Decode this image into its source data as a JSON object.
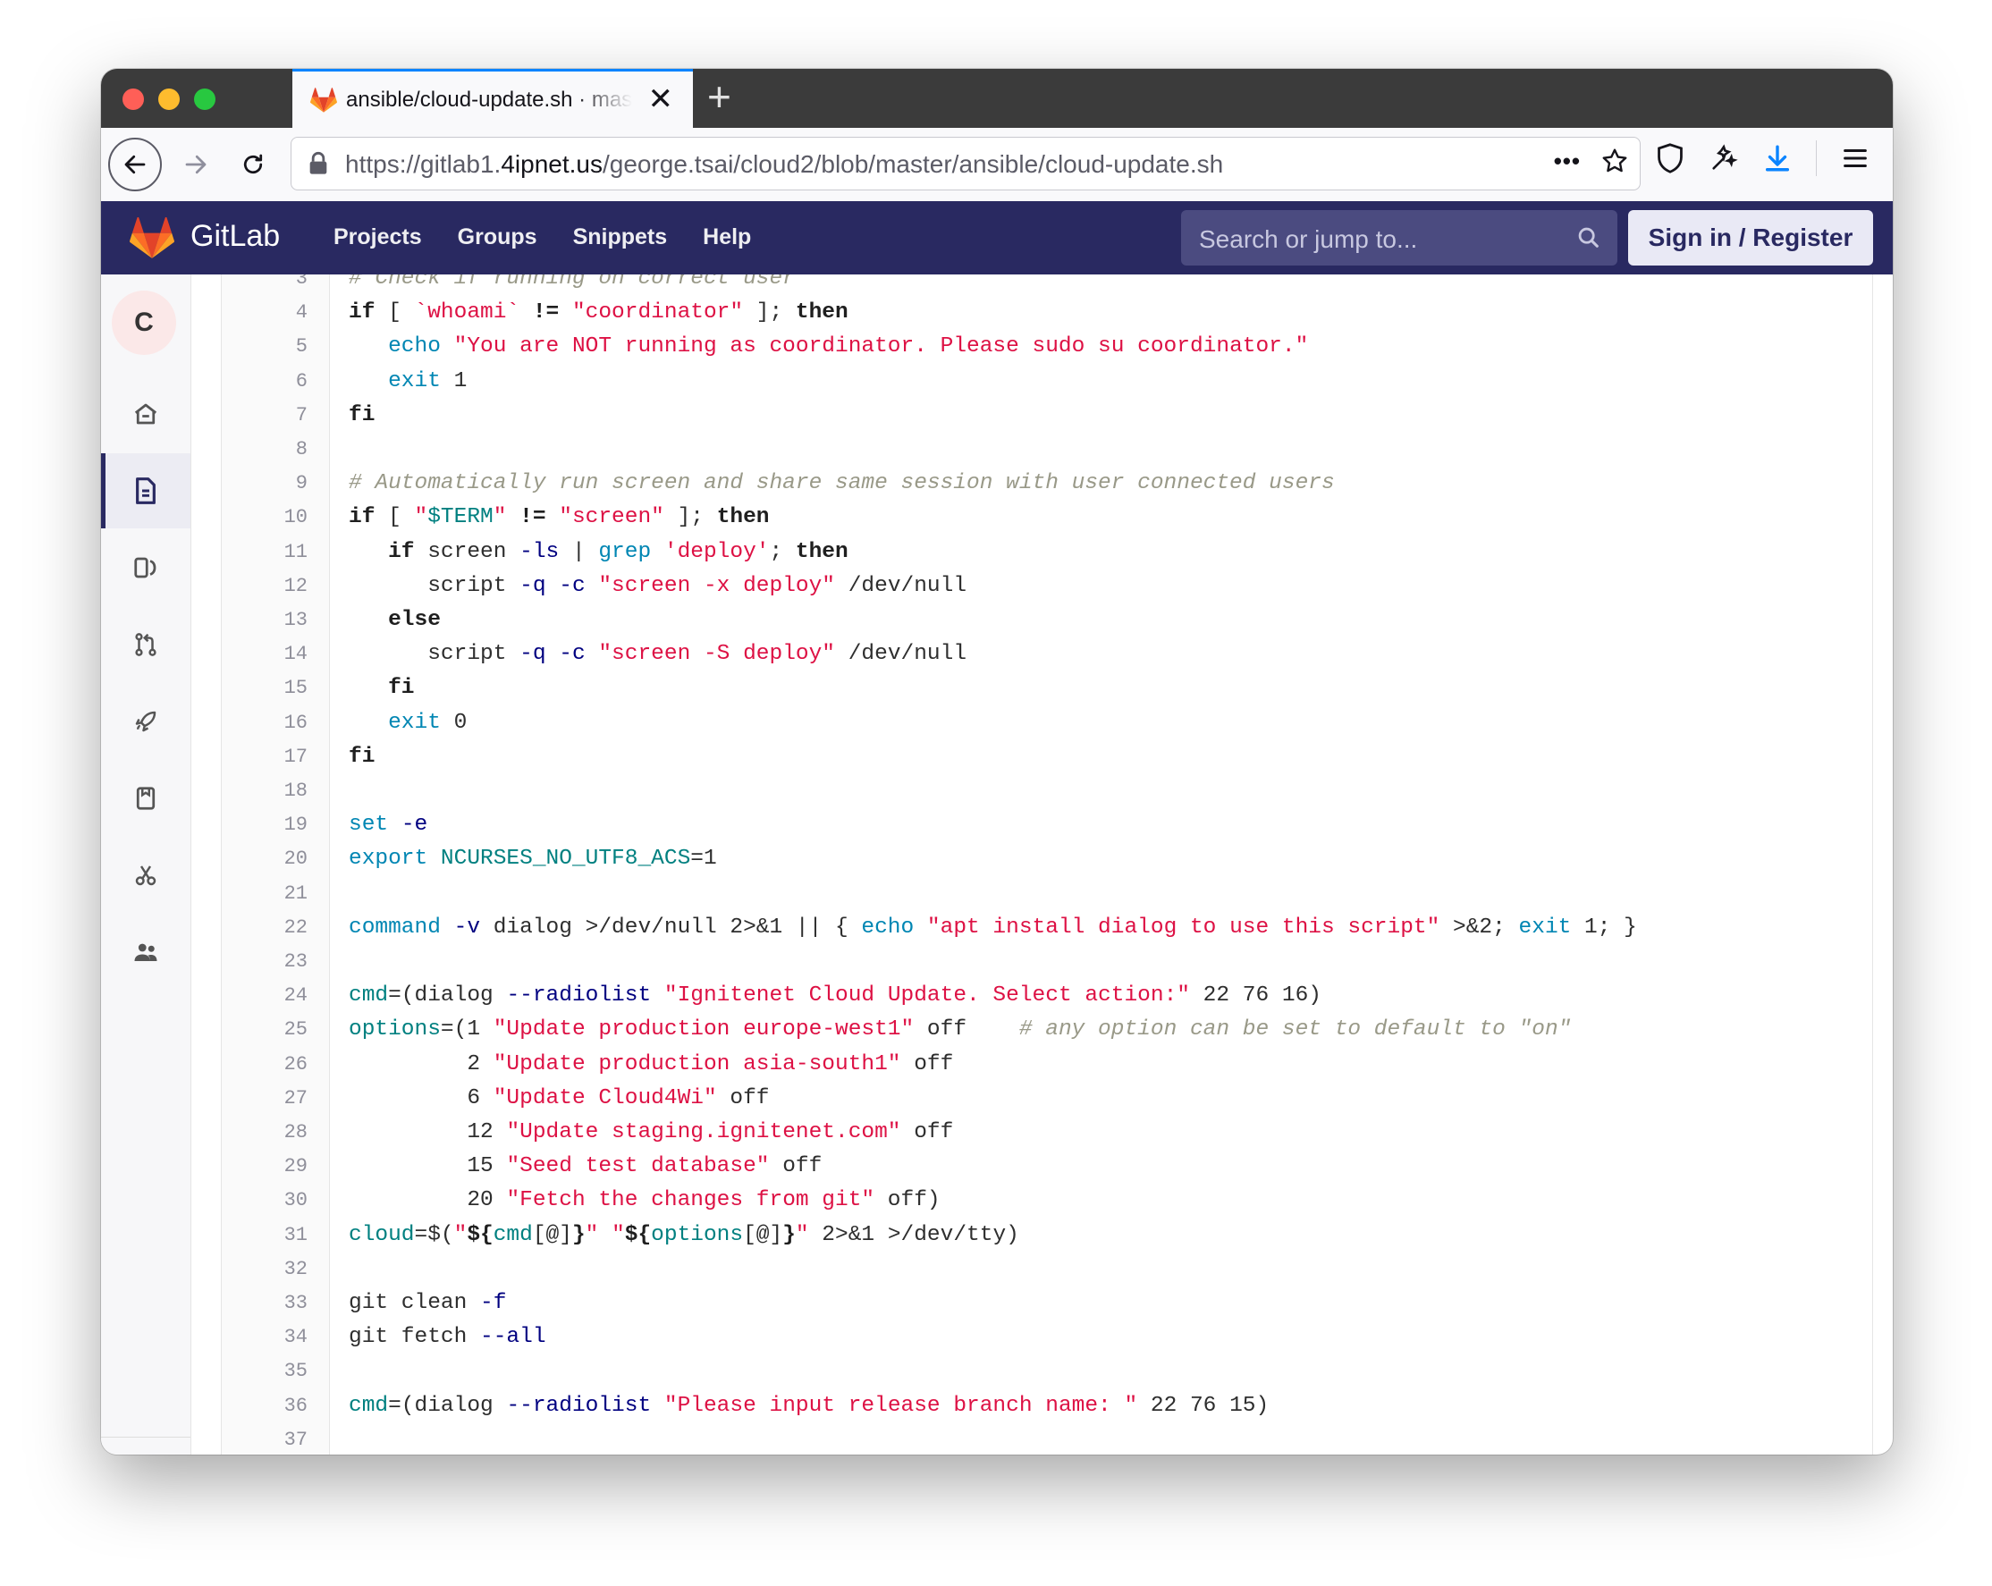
{
  "browser": {
    "tab_title": "ansible/cloud-update.sh · master",
    "url_prefix": "https://gitlab1.",
    "url_domain": "4ipnet.us",
    "url_path": "/george.tsai/cloud2/blob/master/ansible/cloud-update.sh",
    "new_tab_label": "+",
    "close_tab_label": "✕",
    "url_more_label": "•••"
  },
  "gitlab": {
    "brand": "GitLab",
    "nav": [
      "Projects",
      "Groups",
      "Snippets",
      "Help"
    ],
    "search_placeholder": "Search or jump to...",
    "signin_label": "Sign in / Register",
    "avatar_letter": "C"
  },
  "code_lines": [
    {
      "n": "3",
      "segs": [
        [
          "cm",
          "# Check if running on correct user"
        ]
      ]
    },
    {
      "n": "4",
      "segs": [
        [
          "kw",
          "if"
        ],
        [
          "t",
          " [ "
        ],
        [
          "str",
          "`whoami`"
        ],
        [
          "t",
          " "
        ],
        [
          "kw",
          "!="
        ],
        [
          "t",
          " "
        ],
        [
          "str",
          "\"coordinator\""
        ],
        [
          "t",
          " ]; "
        ],
        [
          "kw",
          "then"
        ]
      ]
    },
    {
      "n": "5",
      "segs": [
        [
          "t",
          "   "
        ],
        [
          "bi",
          "echo"
        ],
        [
          "t",
          " "
        ],
        [
          "str",
          "\"You are NOT running as coordinator. Please sudo su coordinator.\""
        ]
      ]
    },
    {
      "n": "6",
      "segs": [
        [
          "t",
          "   "
        ],
        [
          "bi",
          "exit"
        ],
        [
          "t",
          " 1"
        ]
      ]
    },
    {
      "n": "7",
      "segs": [
        [
          "kw",
          "fi"
        ]
      ]
    },
    {
      "n": "8",
      "segs": []
    },
    {
      "n": "9",
      "segs": [
        [
          "cm",
          "# Automatically run screen and share same session with user connected users"
        ]
      ]
    },
    {
      "n": "10",
      "segs": [
        [
          "kw",
          "if"
        ],
        [
          "t",
          " [ "
        ],
        [
          "str",
          "\""
        ],
        [
          "vr",
          "$TERM"
        ],
        [
          "str",
          "\""
        ],
        [
          "t",
          " "
        ],
        [
          "kw",
          "!="
        ],
        [
          "t",
          " "
        ],
        [
          "str",
          "\"screen\""
        ],
        [
          "t",
          " ]; "
        ],
        [
          "kw",
          "then"
        ]
      ]
    },
    {
      "n": "11",
      "segs": [
        [
          "t",
          "   "
        ],
        [
          "kw",
          "if"
        ],
        [
          "t",
          " screen "
        ],
        [
          "op",
          "-ls"
        ],
        [
          "t",
          " | "
        ],
        [
          "bi",
          "grep"
        ],
        [
          "t",
          " "
        ],
        [
          "str",
          "'deploy'"
        ],
        [
          "t",
          "; "
        ],
        [
          "kw",
          "then"
        ]
      ]
    },
    {
      "n": "12",
      "segs": [
        [
          "t",
          "      script "
        ],
        [
          "op",
          "-q"
        ],
        [
          "t",
          " "
        ],
        [
          "op",
          "-c"
        ],
        [
          "t",
          " "
        ],
        [
          "str",
          "\"screen -x deploy\""
        ],
        [
          "t",
          " /dev/null"
        ]
      ]
    },
    {
      "n": "13",
      "segs": [
        [
          "t",
          "   "
        ],
        [
          "kw",
          "else"
        ]
      ]
    },
    {
      "n": "14",
      "segs": [
        [
          "t",
          "      script "
        ],
        [
          "op",
          "-q"
        ],
        [
          "t",
          " "
        ],
        [
          "op",
          "-c"
        ],
        [
          "t",
          " "
        ],
        [
          "str",
          "\"screen -S deploy\""
        ],
        [
          "t",
          " /dev/null"
        ]
      ]
    },
    {
      "n": "15",
      "segs": [
        [
          "t",
          "   "
        ],
        [
          "kw",
          "fi"
        ]
      ]
    },
    {
      "n": "16",
      "segs": [
        [
          "t",
          "   "
        ],
        [
          "bi",
          "exit"
        ],
        [
          "t",
          " 0"
        ]
      ]
    },
    {
      "n": "17",
      "segs": [
        [
          "kw",
          "fi"
        ]
      ]
    },
    {
      "n": "18",
      "segs": []
    },
    {
      "n": "19",
      "segs": [
        [
          "bi",
          "set"
        ],
        [
          "t",
          " "
        ],
        [
          "op",
          "-e"
        ]
      ]
    },
    {
      "n": "20",
      "segs": [
        [
          "bi",
          "export"
        ],
        [
          "t",
          " "
        ],
        [
          "vr",
          "NCURSES_NO_UTF8_ACS"
        ],
        [
          "t",
          "=1"
        ]
      ]
    },
    {
      "n": "21",
      "segs": []
    },
    {
      "n": "22",
      "segs": [
        [
          "bi",
          "command"
        ],
        [
          "t",
          " "
        ],
        [
          "op",
          "-v"
        ],
        [
          "t",
          " dialog >/dev/null 2>&1 || { "
        ],
        [
          "bi",
          "echo"
        ],
        [
          "t",
          " "
        ],
        [
          "str",
          "\"apt install dialog to use this script\""
        ],
        [
          "t",
          " >&2; "
        ],
        [
          "bi",
          "exit"
        ],
        [
          "t",
          " 1; }"
        ]
      ]
    },
    {
      "n": "23",
      "segs": []
    },
    {
      "n": "24",
      "segs": [
        [
          "vr",
          "cmd"
        ],
        [
          "t",
          "=(dialog "
        ],
        [
          "op",
          "--radiolist"
        ],
        [
          "t",
          " "
        ],
        [
          "str",
          "\"Ignitenet Cloud Update. Select action:\""
        ],
        [
          "t",
          " 22 76 16)"
        ]
      ]
    },
    {
      "n": "25",
      "segs": [
        [
          "vr",
          "options"
        ],
        [
          "t",
          "=(1 "
        ],
        [
          "str",
          "\"Update production europe-west1\""
        ],
        [
          "t",
          " off    "
        ],
        [
          "cm",
          "# any option can be set to default to \"on\""
        ]
      ]
    },
    {
      "n": "26",
      "segs": [
        [
          "t",
          "         2 "
        ],
        [
          "str",
          "\"Update production asia-south1\""
        ],
        [
          "t",
          " off"
        ]
      ]
    },
    {
      "n": "27",
      "segs": [
        [
          "t",
          "         6 "
        ],
        [
          "str",
          "\"Update Cloud4Wi\""
        ],
        [
          "t",
          " off"
        ]
      ]
    },
    {
      "n": "28",
      "segs": [
        [
          "t",
          "         12 "
        ],
        [
          "str",
          "\"Update staging.ignitenet.com\""
        ],
        [
          "t",
          " off"
        ]
      ]
    },
    {
      "n": "29",
      "segs": [
        [
          "t",
          "         15 "
        ],
        [
          "str",
          "\"Seed test database\""
        ],
        [
          "t",
          " off"
        ]
      ]
    },
    {
      "n": "30",
      "segs": [
        [
          "t",
          "         20 "
        ],
        [
          "str",
          "\"Fetch the changes from git\""
        ],
        [
          "t",
          " off)"
        ]
      ]
    },
    {
      "n": "31",
      "segs": [
        [
          "vr",
          "cloud"
        ],
        [
          "t",
          "=$("
        ],
        [
          "str",
          "\""
        ],
        [
          "kw",
          "${"
        ],
        [
          "vr",
          "cmd"
        ],
        [
          "t",
          "[@]"
        ],
        [
          "kw",
          "}"
        ],
        [
          "str",
          "\""
        ],
        [
          "t",
          " "
        ],
        [
          "str",
          "\""
        ],
        [
          "kw",
          "${"
        ],
        [
          "vr",
          "options"
        ],
        [
          "t",
          "[@]"
        ],
        [
          "kw",
          "}"
        ],
        [
          "str",
          "\""
        ],
        [
          "t",
          " 2>&1 >/dev/tty)"
        ]
      ]
    },
    {
      "n": "32",
      "segs": []
    },
    {
      "n": "33",
      "segs": [
        [
          "t",
          "git clean "
        ],
        [
          "op",
          "-f"
        ]
      ]
    },
    {
      "n": "34",
      "segs": [
        [
          "t",
          "git fetch "
        ],
        [
          "op",
          "--all"
        ]
      ]
    },
    {
      "n": "35",
      "segs": []
    },
    {
      "n": "36",
      "segs": [
        [
          "vr",
          "cmd"
        ],
        [
          "t",
          "=(dialog "
        ],
        [
          "op",
          "--radiolist"
        ],
        [
          "t",
          " "
        ],
        [
          "str",
          "\"Please input release branch name: \""
        ],
        [
          "t",
          " 22 76 15)"
        ]
      ]
    },
    {
      "n": "37",
      "segs": []
    }
  ],
  "colors": {
    "header_bg": "#292961",
    "string": "#dd1144",
    "comment": "#999988",
    "builtin": "#0086b3",
    "variable": "#008080"
  },
  "icons": {
    "sidebar": [
      "home-icon",
      "file-icon",
      "issues-icon",
      "merge-request-icon",
      "rocket-icon",
      "clipboard-icon",
      "scissors-icon",
      "users-icon"
    ]
  }
}
